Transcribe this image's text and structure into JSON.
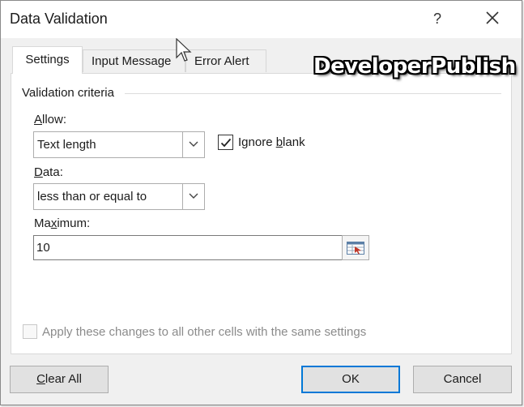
{
  "dialog": {
    "title": "Data Validation",
    "help_label": "?",
    "close_icon": "close-icon"
  },
  "tabs": [
    {
      "label": "Settings",
      "active": true
    },
    {
      "label": "Input Message",
      "active": false
    },
    {
      "label": "Error Alert",
      "active": false
    }
  ],
  "watermark": "DeveloperPublish",
  "criteria": {
    "group_label": "Validation criteria",
    "allow": {
      "label_pre": "",
      "label_key": "A",
      "label_post": "llow:",
      "value": "Text length"
    },
    "ignore_blank": {
      "label_pre": "Ignore ",
      "label_key": "b",
      "label_post": "lank",
      "checked": true
    },
    "data": {
      "label_pre": "",
      "label_key": "D",
      "label_post": "ata:",
      "value": "less than or equal to"
    },
    "maximum": {
      "label_pre": "Ma",
      "label_key": "x",
      "label_post": "imum:",
      "value": "10"
    }
  },
  "apply_all": {
    "label": "Apply these changes to all other cells with the same settings",
    "checked": false,
    "enabled": false
  },
  "buttons": {
    "clear_all_pre": "",
    "clear_all_key": "C",
    "clear_all_post": "lear All",
    "ok": "OK",
    "cancel": "Cancel"
  },
  "colors": {
    "accent": "#0078d7",
    "dialog_bg": "#f0f0f0",
    "panel_bg": "#ffffff"
  }
}
